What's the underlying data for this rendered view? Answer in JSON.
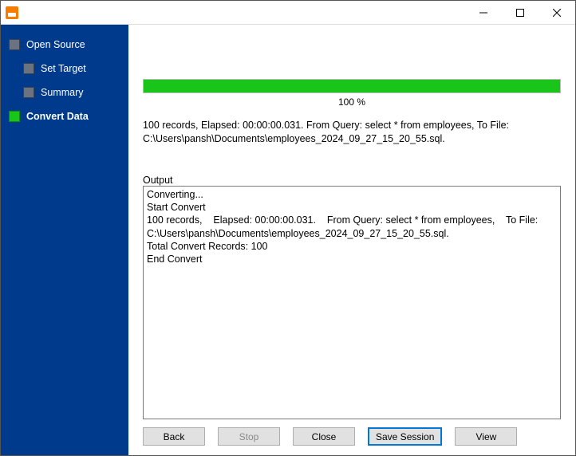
{
  "sidebar": {
    "steps": [
      {
        "label": "Open Source",
        "indent": 0,
        "active": false
      },
      {
        "label": "Set Target",
        "indent": 1,
        "active": false
      },
      {
        "label": "Summary",
        "indent": 1,
        "active": false
      },
      {
        "label": "Convert Data",
        "indent": 0,
        "active": true
      }
    ]
  },
  "progress": {
    "percent_text": "100 %",
    "fill_percent": 100
  },
  "status_line": "100 records,    Elapsed: 00:00:00.031.    From Query: select * from employees,    To File: C:\\Users\\pansh\\Documents\\employees_2024_09_27_15_20_55.sql.",
  "output": {
    "label": "Output",
    "text": "Converting...\nStart Convert\n100 records,    Elapsed: 00:00:00.031.    From Query: select * from employees,    To File: C:\\Users\\pansh\\Documents\\employees_2024_09_27_15_20_55.sql.\nTotal Convert Records: 100\nEnd Convert"
  },
  "buttons": {
    "back": "Back",
    "stop": "Stop",
    "close": "Close",
    "save_session": "Save Session",
    "view": "View"
  }
}
